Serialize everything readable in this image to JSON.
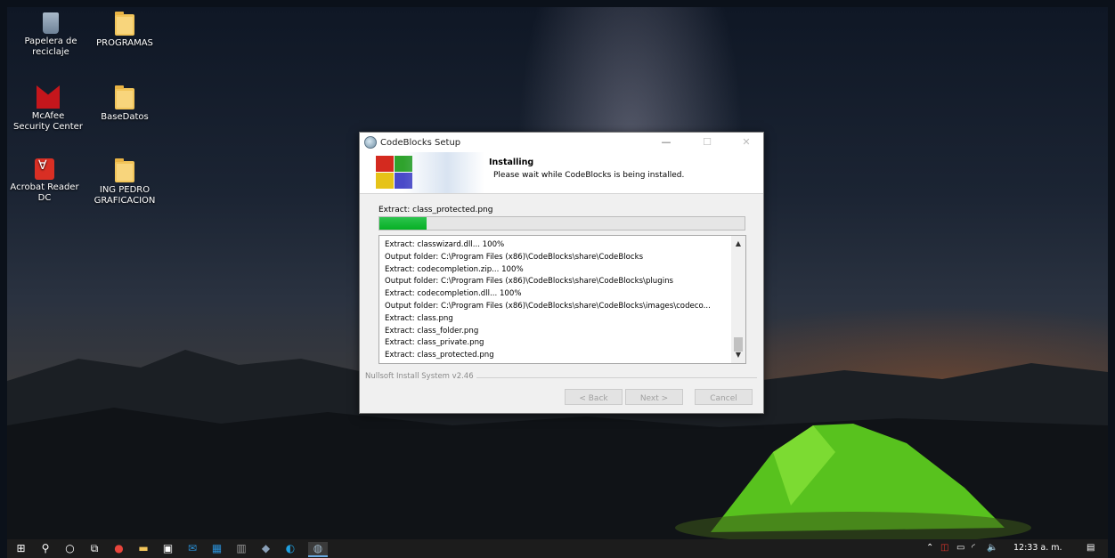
{
  "desktop": {
    "icons": [
      {
        "label": "Papelera de reciclaje"
      },
      {
        "label": "PROGRAMAS"
      },
      {
        "label": "McAfee Security Center"
      },
      {
        "label": "BaseDatos"
      },
      {
        "label": "Acrobat Reader DC"
      },
      {
        "label": "ING PEDRO GRAFICACION"
      }
    ]
  },
  "window": {
    "title": "CodeBlocks Setup",
    "minimize_label": "—",
    "maximize_label": "☐",
    "close_label": "✕",
    "header_title": "Installing",
    "header_subtitle": "Please wait while CodeBlocks is being installed.",
    "status": "Extract: class_protected.png",
    "progress_percent": 13,
    "log": [
      "Extract: classwizard.dll... 100%",
      "Output folder: C:\\Program Files (x86)\\CodeBlocks\\share\\CodeBlocks",
      "Extract: codecompletion.zip... 100%",
      "Output folder: C:\\Program Files (x86)\\CodeBlocks\\share\\CodeBlocks\\plugins",
      "Extract: codecompletion.dll... 100%",
      "Output folder: C:\\Program Files (x86)\\CodeBlocks\\share\\CodeBlocks\\images\\codeco...",
      "Extract: class.png",
      "Extract: class_folder.png",
      "Extract: class_private.png",
      "Extract: class_protected.png"
    ],
    "branding": "Nullsoft Install System v2.46",
    "buttons": {
      "back": "< Back",
      "next": "Next >",
      "cancel": "Cancel"
    }
  },
  "taskbar": {
    "items": [
      "windows-logo-icon",
      "search-icon",
      "cortana-icon",
      "task-view-icon",
      "chrome-icon",
      "file-explorer-icon",
      "store-icon",
      "mail-icon",
      "app-icon",
      "app-icon",
      "app-icon",
      "edge-icon",
      "codeblocks-setup-icon"
    ],
    "clock": "12:33 a. m."
  },
  "colors": {
    "progress": "#06b025",
    "taskbar": "#1c1c1c"
  }
}
